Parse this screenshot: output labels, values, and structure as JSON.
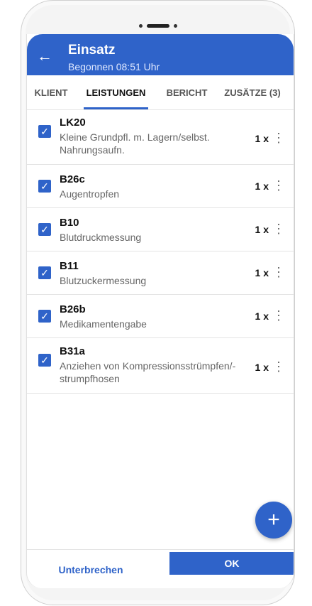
{
  "header": {
    "back_icon": "arrow-back-icon",
    "title": "Einsatz",
    "subtitle": "Begonnen 08:51 Uhr"
  },
  "tabs": [
    {
      "label": "KLIENT"
    },
    {
      "label": "LEISTUNGEN"
    },
    {
      "label": "BERICHT"
    },
    {
      "label": "ZUSÄTZE (3)"
    }
  ],
  "services": [
    {
      "code": "LK20",
      "description": "Kleine Grundpfl. m. Lagern/selbst. Nahrungsaufn.",
      "quantity": "1 x",
      "checked": true
    },
    {
      "code": "B26c",
      "description": "Augentropfen",
      "quantity": "1 x",
      "checked": true
    },
    {
      "code": "B10",
      "description": "Blutdruckmessung",
      "quantity": "1 x",
      "checked": true
    },
    {
      "code": "B11",
      "description": "Blutzuckermessung",
      "quantity": "1 x",
      "checked": true
    },
    {
      "code": "B26b",
      "description": "Medikamentengabe",
      "quantity": "1 x",
      "checked": true
    },
    {
      "code": "B31a",
      "description": "Anziehen von Kompressionsstrümpfen/-strumpfhosen",
      "quantity": "1 x",
      "checked": true
    }
  ],
  "fab": {
    "icon": "plus-icon",
    "symbol": "+"
  },
  "footer": {
    "interrupt_label": "Unterbrechen",
    "ok_label": "OK"
  },
  "colors": {
    "primary": "#2f63c9"
  }
}
